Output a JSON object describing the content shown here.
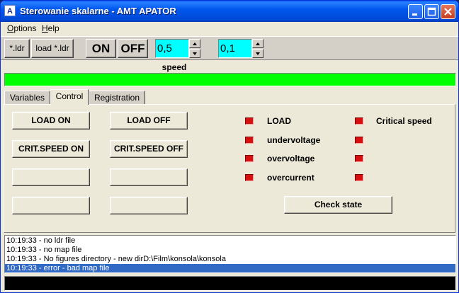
{
  "window": {
    "title": "Sterowanie skalarne - AMT APATOR",
    "icon_letter": "A"
  },
  "menu": {
    "items": [
      {
        "mnemonic": "O",
        "rest": "ptions"
      },
      {
        "mnemonic": "H",
        "rest": "elp"
      }
    ]
  },
  "toolbar": {
    "ldr_label": "*.ldr",
    "load_ldr_label": "load *.ldr",
    "on_label": "ON",
    "off_label": "OFF",
    "spin1_value": "0,5",
    "spin2_value": "0,1"
  },
  "speed": {
    "label": "speed",
    "fill_fraction": 1.0,
    "color": "#00ff00"
  },
  "tabs": [
    {
      "label": "Variables",
      "active": false
    },
    {
      "label": "Control",
      "active": true
    },
    {
      "label": "Registration",
      "active": false
    }
  ],
  "control": {
    "load_on_label": "LOAD ON",
    "load_off_label": "LOAD OFF",
    "crit_on_label": "CRIT.SPEED ON",
    "crit_off_label": "CRIT.SPEED OFF",
    "blank1": "",
    "blank2": "",
    "blank3": "",
    "blank4": "",
    "check_state_label": "Check state",
    "indicators": [
      {
        "label": "LOAD",
        "state": "off",
        "color": "#d61010"
      },
      {
        "label": "undervoltage",
        "state": "off",
        "color": "#d61010"
      },
      {
        "label": "overvoltage",
        "state": "off",
        "color": "#d61010"
      },
      {
        "label": "overcurrent",
        "state": "off",
        "color": "#d61010"
      },
      {
        "label": "Critical speed",
        "state": "off",
        "color": "#d61010"
      },
      {
        "label": "",
        "state": "off",
        "color": "#d61010"
      },
      {
        "label": "",
        "state": "off",
        "color": "#d61010"
      },
      {
        "label": "",
        "state": "off",
        "color": "#d61010"
      }
    ]
  },
  "log": {
    "lines": [
      "10:19:33 - no ldr file",
      "10:19:33 - no map file",
      "10:19:33 - No figures directory - new dirD:\\Film\\konsola\\konsola",
      "10:19:33 - error - bad map file"
    ],
    "selected_index": 3
  },
  "command_line": {
    "value": ""
  }
}
